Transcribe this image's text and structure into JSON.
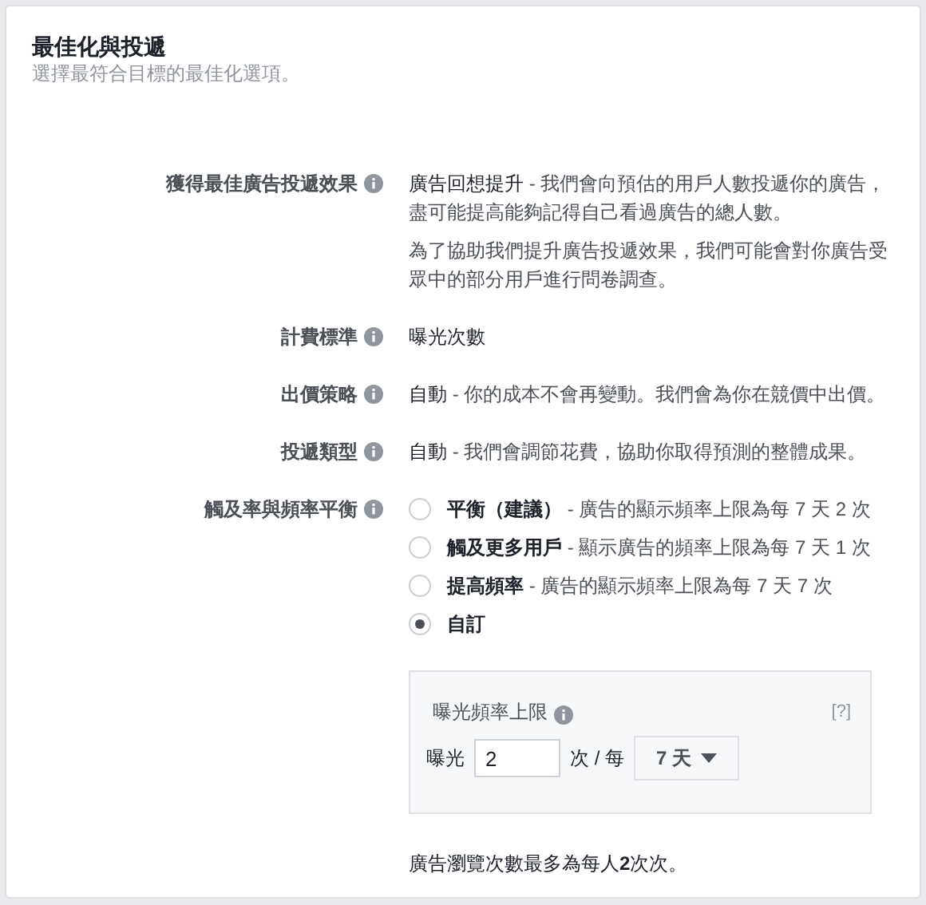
{
  "header": {
    "title": "最佳化與投遞",
    "subtitle": "選擇最符合目標的最佳化選項。"
  },
  "rows": [
    {
      "label": "獲得最佳廣告投遞效果",
      "value": {
        "title": "廣告回想提升",
        "description": " - 我們會向預估的用戶人數投遞你的廣告，盡可能提高能夠記得自己看過廣告的總人數。"
      },
      "note": "為了協助我們提升廣告投遞效果，我們可能會對你廣告受眾中的部分用戶進行問卷調查。"
    },
    {
      "label": "計費標準",
      "value": {
        "title": "曝光次數"
      }
    },
    {
      "label": "出價策略",
      "value": {
        "title": "自動",
        "description": " - 你的成本不會再變動。我們會為你在競價中出價。"
      }
    },
    {
      "label": "投遞類型",
      "value": {
        "title": "自動",
        "description": " - 我們會調節花費，協助你取得預測的整體成果。"
      }
    }
  ],
  "balance": {
    "label": "觸及率與頻率平衡",
    "options": [
      {
        "title": "平衡（建議）",
        "description": " - 廣告的顯示頻率上限為每 7 天 2 次",
        "selected": false
      },
      {
        "title": "觸及更多用戶",
        "description": " - 顯示廣告的頻率上限為每 7 天 1 次",
        "selected": false
      },
      {
        "title": "提高頻率",
        "description": " - 廣告的顯示頻率上限為每 7 天 7 次",
        "selected": false
      },
      {
        "title": "自訂",
        "selected": true
      }
    ],
    "cap": {
      "title": "曝光頻率上限",
      "help": "[?]",
      "prefix": "曝光",
      "value": "2",
      "unit": "次 / 每",
      "period": "7 天"
    },
    "summary": "廣告瀏覽次數最多為每人**2**次次。"
  }
}
